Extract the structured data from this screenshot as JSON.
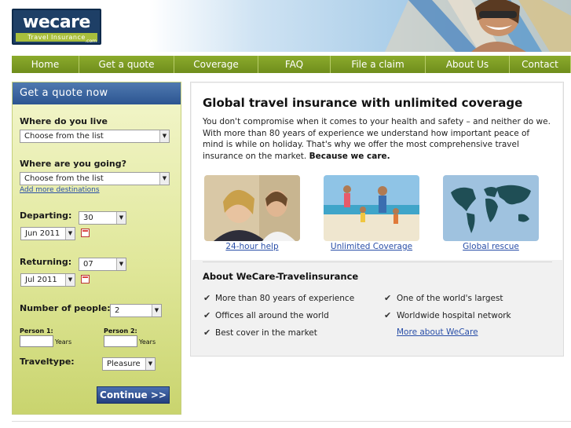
{
  "header": {
    "logo_brand": "wecare",
    "logo_tagline": "Travel Insurance",
    "logo_suffix": ".com"
  },
  "nav": [
    {
      "label": "Home",
      "width": 86
    },
    {
      "label": "Get a quote",
      "width": 121
    },
    {
      "label": "Coverage",
      "width": 107
    },
    {
      "label": "FAQ",
      "width": 92
    },
    {
      "label": "File a claim",
      "width": 121
    },
    {
      "label": "About Us",
      "width": 107
    },
    {
      "label": "Contact",
      "width": 78
    }
  ],
  "quote": {
    "title": "Get a quote now",
    "live_label": "Where do you live",
    "live_value": "Choose from the list",
    "going_label": "Where are you going?",
    "going_value": "Choose from the list",
    "add_destinations": "Add more destinations",
    "departing_label": "Departing:",
    "departing_day": "30",
    "departing_month": "Jun 2011",
    "returning_label": "Returning:",
    "returning_day": "07",
    "returning_month": "Jul 2011",
    "people_label": "Number of people:",
    "people_value": "2",
    "person1_label": "Person 1:",
    "person2_label": "Person 2:",
    "years": "Years",
    "traveltype_label": "Traveltype:",
    "traveltype_value": "Pleasure",
    "continue_label": "Continue >>"
  },
  "main": {
    "title": "Global travel insurance with unlimited coverage",
    "intro": "You don't compromise when it comes to your health and safety – and neither do we. With more than 80 years of experience we understand how important peace of mind is while on holiday. That's why we offer the most comprehensive travel insurance on the market.",
    "intro_bold": "Because we care.",
    "links": [
      "24-hour help",
      "Unlimited Coverage",
      "Global rescue"
    ],
    "about_title": "About WeCare-Travelinsurance",
    "features_left": [
      "More than 80 years of experience",
      "Offices all around the world",
      "Best cover in the market"
    ],
    "features_right": [
      "One of the world's largest",
      "Worldwide hospital network"
    ],
    "more_link": "More about WeCare"
  }
}
